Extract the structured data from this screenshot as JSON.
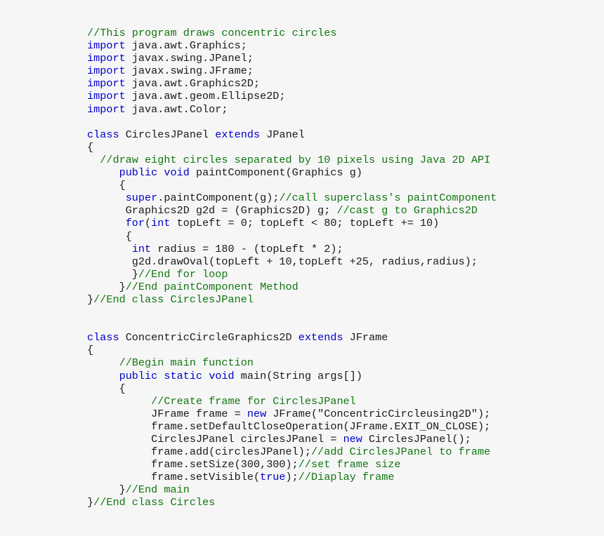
{
  "editor": {
    "language": "java",
    "colors": {
      "background": "#f6f6f6",
      "keyword": "#0000cc",
      "comment": "#117711",
      "text": "#1a1a1a"
    },
    "lines": [
      [
        {
          "t": "cm",
          "v": "//This program draws concentric circles"
        }
      ],
      [
        {
          "t": "kw",
          "v": "import"
        },
        {
          "t": "tx",
          "v": " java.awt.Graphics;"
        }
      ],
      [
        {
          "t": "kw",
          "v": "import"
        },
        {
          "t": "tx",
          "v": " javax.swing.JPanel;"
        }
      ],
      [
        {
          "t": "kw",
          "v": "import"
        },
        {
          "t": "tx",
          "v": " javax.swing.JFrame;"
        }
      ],
      [
        {
          "t": "kw",
          "v": "import"
        },
        {
          "t": "tx",
          "v": " java.awt.Graphics2D;"
        }
      ],
      [
        {
          "t": "kw",
          "v": "import"
        },
        {
          "t": "tx",
          "v": " java.awt.geom.Ellipse2D;"
        }
      ],
      [
        {
          "t": "kw",
          "v": "import"
        },
        {
          "t": "tx",
          "v": " java.awt.Color;"
        }
      ],
      [],
      [
        {
          "t": "kw",
          "v": "class"
        },
        {
          "t": "tx",
          "v": " CirclesJPanel "
        },
        {
          "t": "kw",
          "v": "extends"
        },
        {
          "t": "tx",
          "v": " JPanel"
        }
      ],
      [
        {
          "t": "tx",
          "v": "{"
        }
      ],
      [
        {
          "t": "cm",
          "v": "  //draw eight circles separated by 10 pixels using Java 2D API"
        }
      ],
      [
        {
          "t": "tx",
          "v": "     "
        },
        {
          "t": "kw",
          "v": "public"
        },
        {
          "t": "tx",
          "v": " "
        },
        {
          "t": "kw",
          "v": "void"
        },
        {
          "t": "tx",
          "v": " paintComponent(Graphics g)"
        }
      ],
      [
        {
          "t": "tx",
          "v": "     {"
        }
      ],
      [
        {
          "t": "tx",
          "v": "      "
        },
        {
          "t": "kw",
          "v": "super"
        },
        {
          "t": "tx",
          "v": ".paintComponent(g);"
        },
        {
          "t": "cm",
          "v": "//call superclass's paintComponent"
        }
      ],
      [
        {
          "t": "tx",
          "v": "      Graphics2D g2d = (Graphics2D) g; "
        },
        {
          "t": "cm",
          "v": "//cast g to Graphics2D"
        }
      ],
      [
        {
          "t": "tx",
          "v": "      "
        },
        {
          "t": "kw",
          "v": "for"
        },
        {
          "t": "tx",
          "v": "("
        },
        {
          "t": "kw",
          "v": "int"
        },
        {
          "t": "tx",
          "v": " topLeft = 0; topLeft < 80; topLeft += 10)"
        }
      ],
      [
        {
          "t": "tx",
          "v": "      {"
        }
      ],
      [
        {
          "t": "tx",
          "v": "       "
        },
        {
          "t": "kw",
          "v": "int"
        },
        {
          "t": "tx",
          "v": " radius = 180 - (topLeft * 2);"
        }
      ],
      [
        {
          "t": "tx",
          "v": "       g2d.drawOval(topLeft + 10,topLeft +25, radius,radius);"
        }
      ],
      [
        {
          "t": "tx",
          "v": "       }"
        },
        {
          "t": "cm",
          "v": "//End for loop"
        }
      ],
      [
        {
          "t": "tx",
          "v": "     }"
        },
        {
          "t": "cm",
          "v": "//End paintComponent Method"
        }
      ],
      [
        {
          "t": "tx",
          "v": "}"
        },
        {
          "t": "cm",
          "v": "//End class CirclesJPanel"
        }
      ],
      [],
      [],
      [
        {
          "t": "kw",
          "v": "class"
        },
        {
          "t": "tx",
          "v": " ConcentricCircleGraphics2D "
        },
        {
          "t": "kw",
          "v": "extends"
        },
        {
          "t": "tx",
          "v": " JFrame"
        }
      ],
      [
        {
          "t": "tx",
          "v": "{"
        }
      ],
      [
        {
          "t": "tx",
          "v": "     "
        },
        {
          "t": "cm",
          "v": "//Begin main function"
        }
      ],
      [
        {
          "t": "tx",
          "v": "     "
        },
        {
          "t": "kw",
          "v": "public"
        },
        {
          "t": "tx",
          "v": " "
        },
        {
          "t": "kw",
          "v": "static"
        },
        {
          "t": "tx",
          "v": " "
        },
        {
          "t": "kw",
          "v": "void"
        },
        {
          "t": "tx",
          "v": " main(String args[])"
        }
      ],
      [
        {
          "t": "tx",
          "v": "     {"
        }
      ],
      [
        {
          "t": "tx",
          "v": "          "
        },
        {
          "t": "cm",
          "v": "//Create frame for CirclesJPanel"
        }
      ],
      [
        {
          "t": "tx",
          "v": "          JFrame frame = "
        },
        {
          "t": "kw",
          "v": "new"
        },
        {
          "t": "tx",
          "v": " JFrame(\"ConcentricCircleusing2D\");"
        }
      ],
      [
        {
          "t": "tx",
          "v": "          frame.setDefaultCloseOperation(JFrame.EXIT_ON_CLOSE);"
        }
      ],
      [
        {
          "t": "tx",
          "v": "          CirclesJPanel circlesJPanel = "
        },
        {
          "t": "kw",
          "v": "new"
        },
        {
          "t": "tx",
          "v": " CirclesJPanel();"
        }
      ],
      [
        {
          "t": "tx",
          "v": "          frame.add(circlesJPanel);"
        },
        {
          "t": "cm",
          "v": "//add CirclesJPanel to frame"
        }
      ],
      [
        {
          "t": "tx",
          "v": "          frame.setSize(300,300);"
        },
        {
          "t": "cm",
          "v": "//set frame size"
        }
      ],
      [
        {
          "t": "tx",
          "v": "          frame.setVisible("
        },
        {
          "t": "kw",
          "v": "true"
        },
        {
          "t": "tx",
          "v": ");"
        },
        {
          "t": "cm",
          "v": "//Diaplay frame"
        }
      ],
      [
        {
          "t": "tx",
          "v": "     }"
        },
        {
          "t": "cm",
          "v": "//End main"
        }
      ],
      [
        {
          "t": "tx",
          "v": "}"
        },
        {
          "t": "cm",
          "v": "//End class Circles"
        }
      ]
    ]
  }
}
